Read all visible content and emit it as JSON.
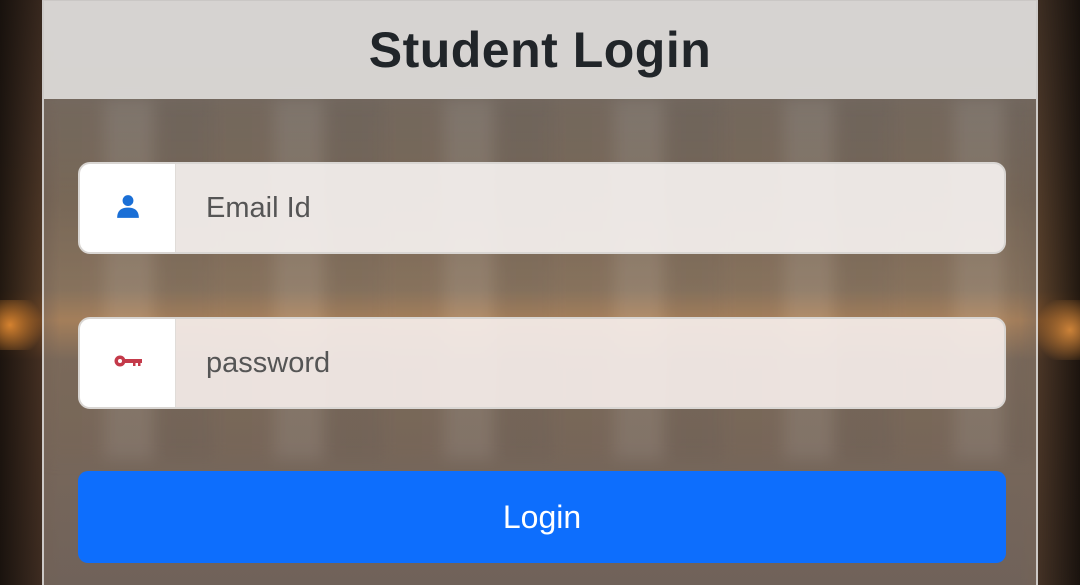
{
  "header": {
    "title": "Student Login"
  },
  "form": {
    "email": {
      "placeholder": "Email Id",
      "value": "",
      "icon": "user-icon",
      "icon_color": "#1a6fd6"
    },
    "password": {
      "placeholder": "password",
      "value": "",
      "icon": "key-icon",
      "icon_color": "#c43a4a"
    },
    "login_label": "Login"
  },
  "colors": {
    "accent": "#0d6efd",
    "title": "#212529"
  }
}
